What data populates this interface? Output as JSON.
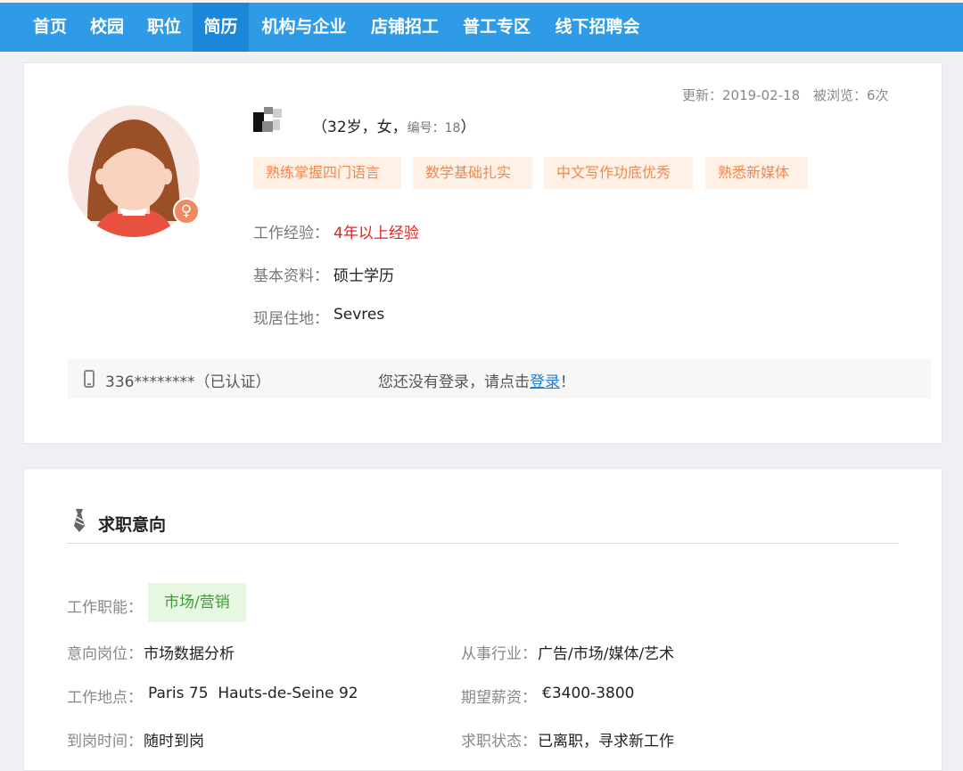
{
  "nav": {
    "items": [
      "首页",
      "校园",
      "职位",
      "简历",
      "机构与企业",
      "店铺招工",
      "普工专区",
      "线下招聘会"
    ],
    "active": "简历"
  },
  "meta": {
    "update_label": "更新：2019-02-18",
    "views_label": "被浏览：6次"
  },
  "profile": {
    "info_main": "（32岁，女，",
    "info_num": "编号：18",
    "info_end": "）",
    "gender_symbol": "♀",
    "tags": [
      "熟练掌握四门语言",
      "数学基础扎实",
      "中文写作功底优秀",
      "熟悉新媒体"
    ],
    "experience_label": "工作经验：",
    "experience_value": "4年以上经验",
    "education_label": "基本资料：",
    "education_value": "硕士学历",
    "location_label": "现居住地：",
    "location_value": "Sevres"
  },
  "contact": {
    "phone": "336********（已认证）",
    "login_prefix": "您还没有登录，请点击",
    "login_link": "登录",
    "login_suffix": "！"
  },
  "intent": {
    "title": "求职意向",
    "function_label": "工作职能：",
    "function_value": "市场/营销",
    "position_label": "意向岗位：",
    "position_value": "市场数据分析",
    "industry_label": "从事行业：",
    "industry_value": "广告/市场/媒体/艺术",
    "place_label": "工作地点：",
    "place_value": "Paris 75  Hauts-de-Seine 92",
    "salary_label": "期望薪资：",
    "salary_value": "€3400-3800",
    "start_label": "到岗时间：",
    "start_value": "随时到岗",
    "status_label": "求职状态：",
    "status_value": "已离职，寻求新工作"
  },
  "colors": {
    "nav_bg": "#2f9be6",
    "nav_active": "#1c87d9",
    "tag_text": "#f0884e",
    "tag_bg": "#fff1e6",
    "experience_red": "#e4221b",
    "function_green": "#3e9b36",
    "link_blue": "#1c7fd1"
  }
}
